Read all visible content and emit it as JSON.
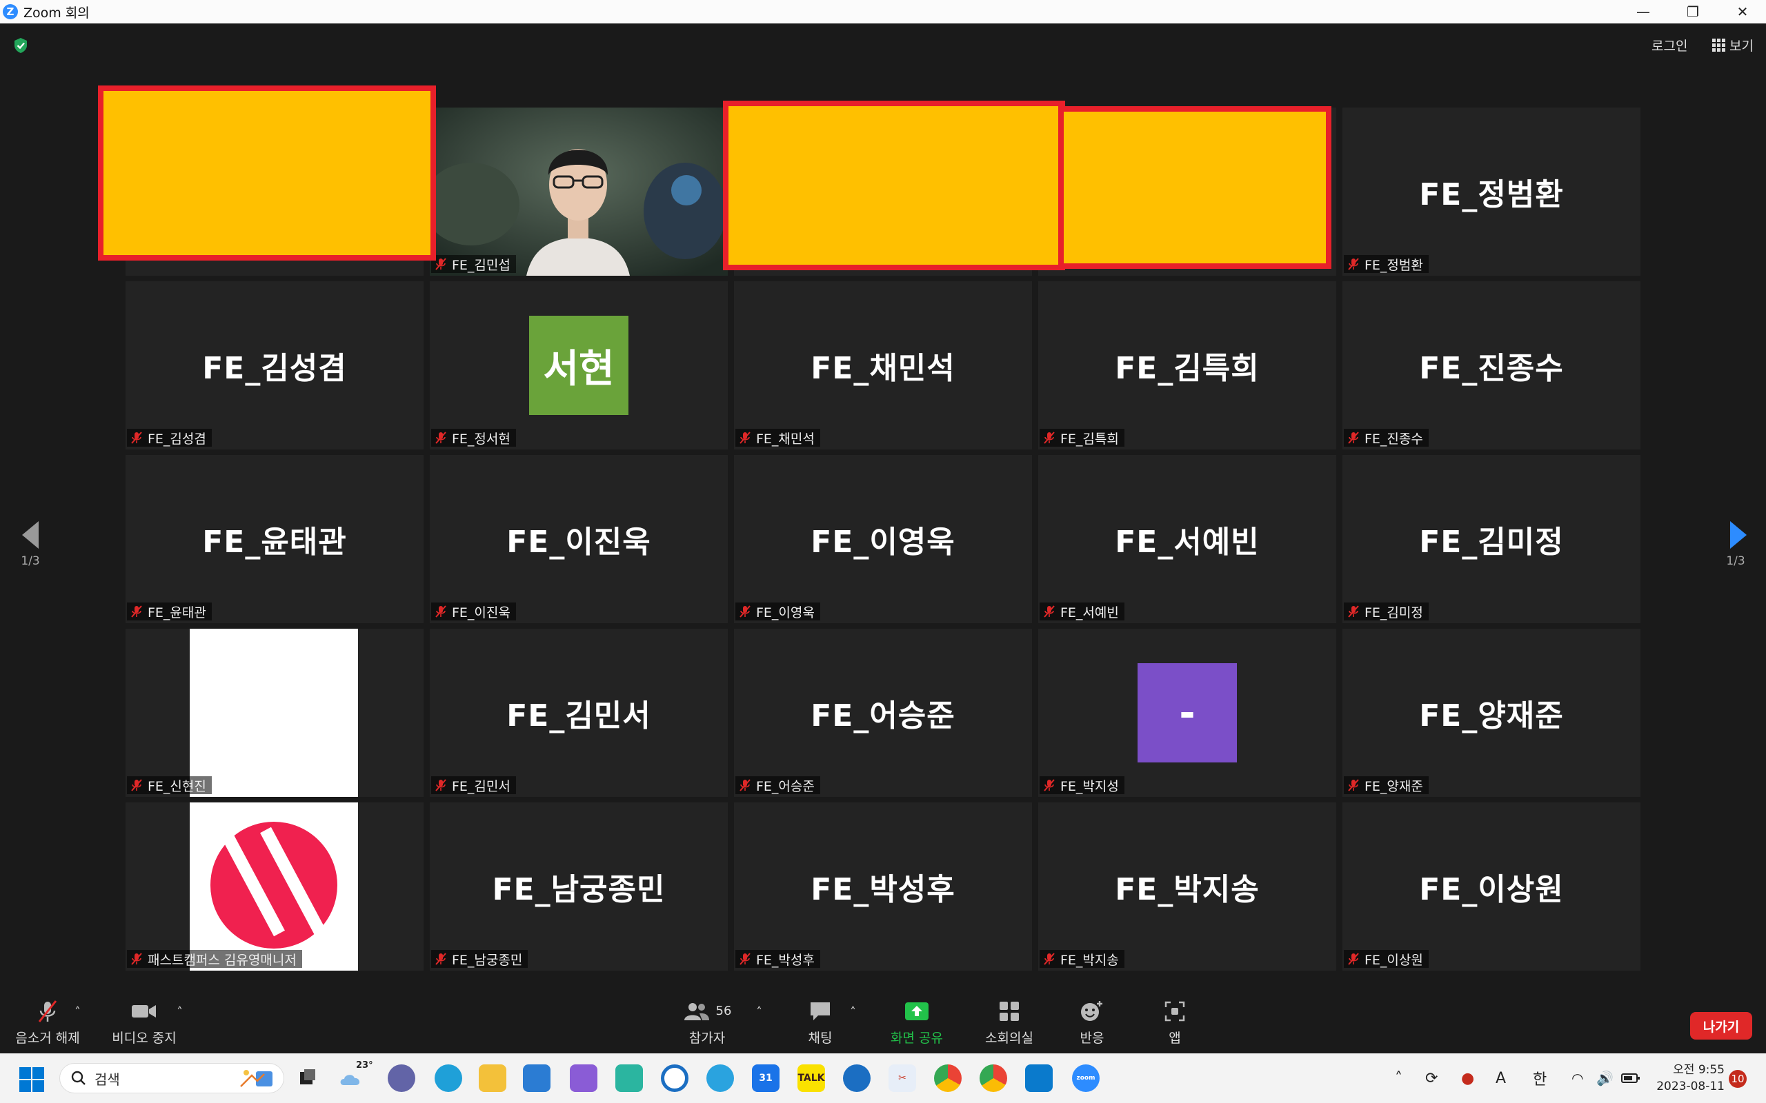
{
  "window": {
    "title": "Zoom 회의"
  },
  "topbar": {
    "login_label": "로그인",
    "view_label": "보기"
  },
  "pager": {
    "left_page": "1/3",
    "right_page": "1/3"
  },
  "tiles": [
    {
      "name": "",
      "label": "",
      "redacted": true
    },
    {
      "name": "",
      "label": "FE_김민섭",
      "video": true
    },
    {
      "name": "",
      "label": "",
      "redacted": true
    },
    {
      "name": "",
      "label": "",
      "redacted": true
    },
    {
      "name": "FE_정범환",
      "label": "FE_정범환"
    },
    {
      "name": "FE_김성겸",
      "label": "FE_김성겸"
    },
    {
      "name": "서현",
      "label": "FE_정서현",
      "avatar": "green"
    },
    {
      "name": "FE_채민석",
      "label": "FE_채민석"
    },
    {
      "name": "FE_김특희",
      "label": "FE_김특희"
    },
    {
      "name": "FE_진종수",
      "label": "FE_진종수"
    },
    {
      "name": "FE_윤태관",
      "label": "FE_윤태관"
    },
    {
      "name": "FE_이진욱",
      "label": "FE_이진욱"
    },
    {
      "name": "FE_이영욱",
      "label": "FE_이영욱"
    },
    {
      "name": "FE_서예빈",
      "label": "FE_서예빈"
    },
    {
      "name": "FE_김미정",
      "label": "FE_김미정"
    },
    {
      "name": "",
      "label": "FE_신현진",
      "avatar": "white"
    },
    {
      "name": "FE_김민서",
      "label": "FE_김민서"
    },
    {
      "name": "FE_어승준",
      "label": "FE_어승준"
    },
    {
      "name": "-",
      "label": "FE_박지성",
      "avatar": "purple"
    },
    {
      "name": "FE_양재준",
      "label": "FE_양재준"
    },
    {
      "name": "",
      "label": "패스트캠퍼스 김유영매니저",
      "avatar": "logo"
    },
    {
      "name": "FE_남궁종민",
      "label": "FE_남궁종민"
    },
    {
      "name": "FE_박성후",
      "label": "FE_박성후"
    },
    {
      "name": "FE_박지송",
      "label": "FE_박지송"
    },
    {
      "name": "FE_이상원",
      "label": "FE_이상원"
    }
  ],
  "toolbar": {
    "unmute_label": "음소거 해제",
    "stop_video_label": "비디오 중지",
    "participants_label": "참가자",
    "participants_count": "56",
    "chat_label": "채팅",
    "share_label": "화면 공유",
    "breakout_label": "소회의실",
    "reactions_label": "반응",
    "apps_label": "앱",
    "leave_label": "나가기"
  },
  "taskbar": {
    "search_placeholder": "검색",
    "weather_temp": "23°",
    "tray_lang_a": "A",
    "tray_lang_ko": "한",
    "time": "오전 9:55",
    "date": "2023-08-11",
    "notification_count": "10"
  },
  "colors": {
    "accent": "#2d8cff",
    "share_green": "#22c24a",
    "leave_red": "#e02828",
    "redact_fill": "#ffc000",
    "redact_border": "#e8202a",
    "avatar_green": "#6aa33a",
    "avatar_purple": "#7b4fc8",
    "logo_pink": "#f0214f"
  }
}
